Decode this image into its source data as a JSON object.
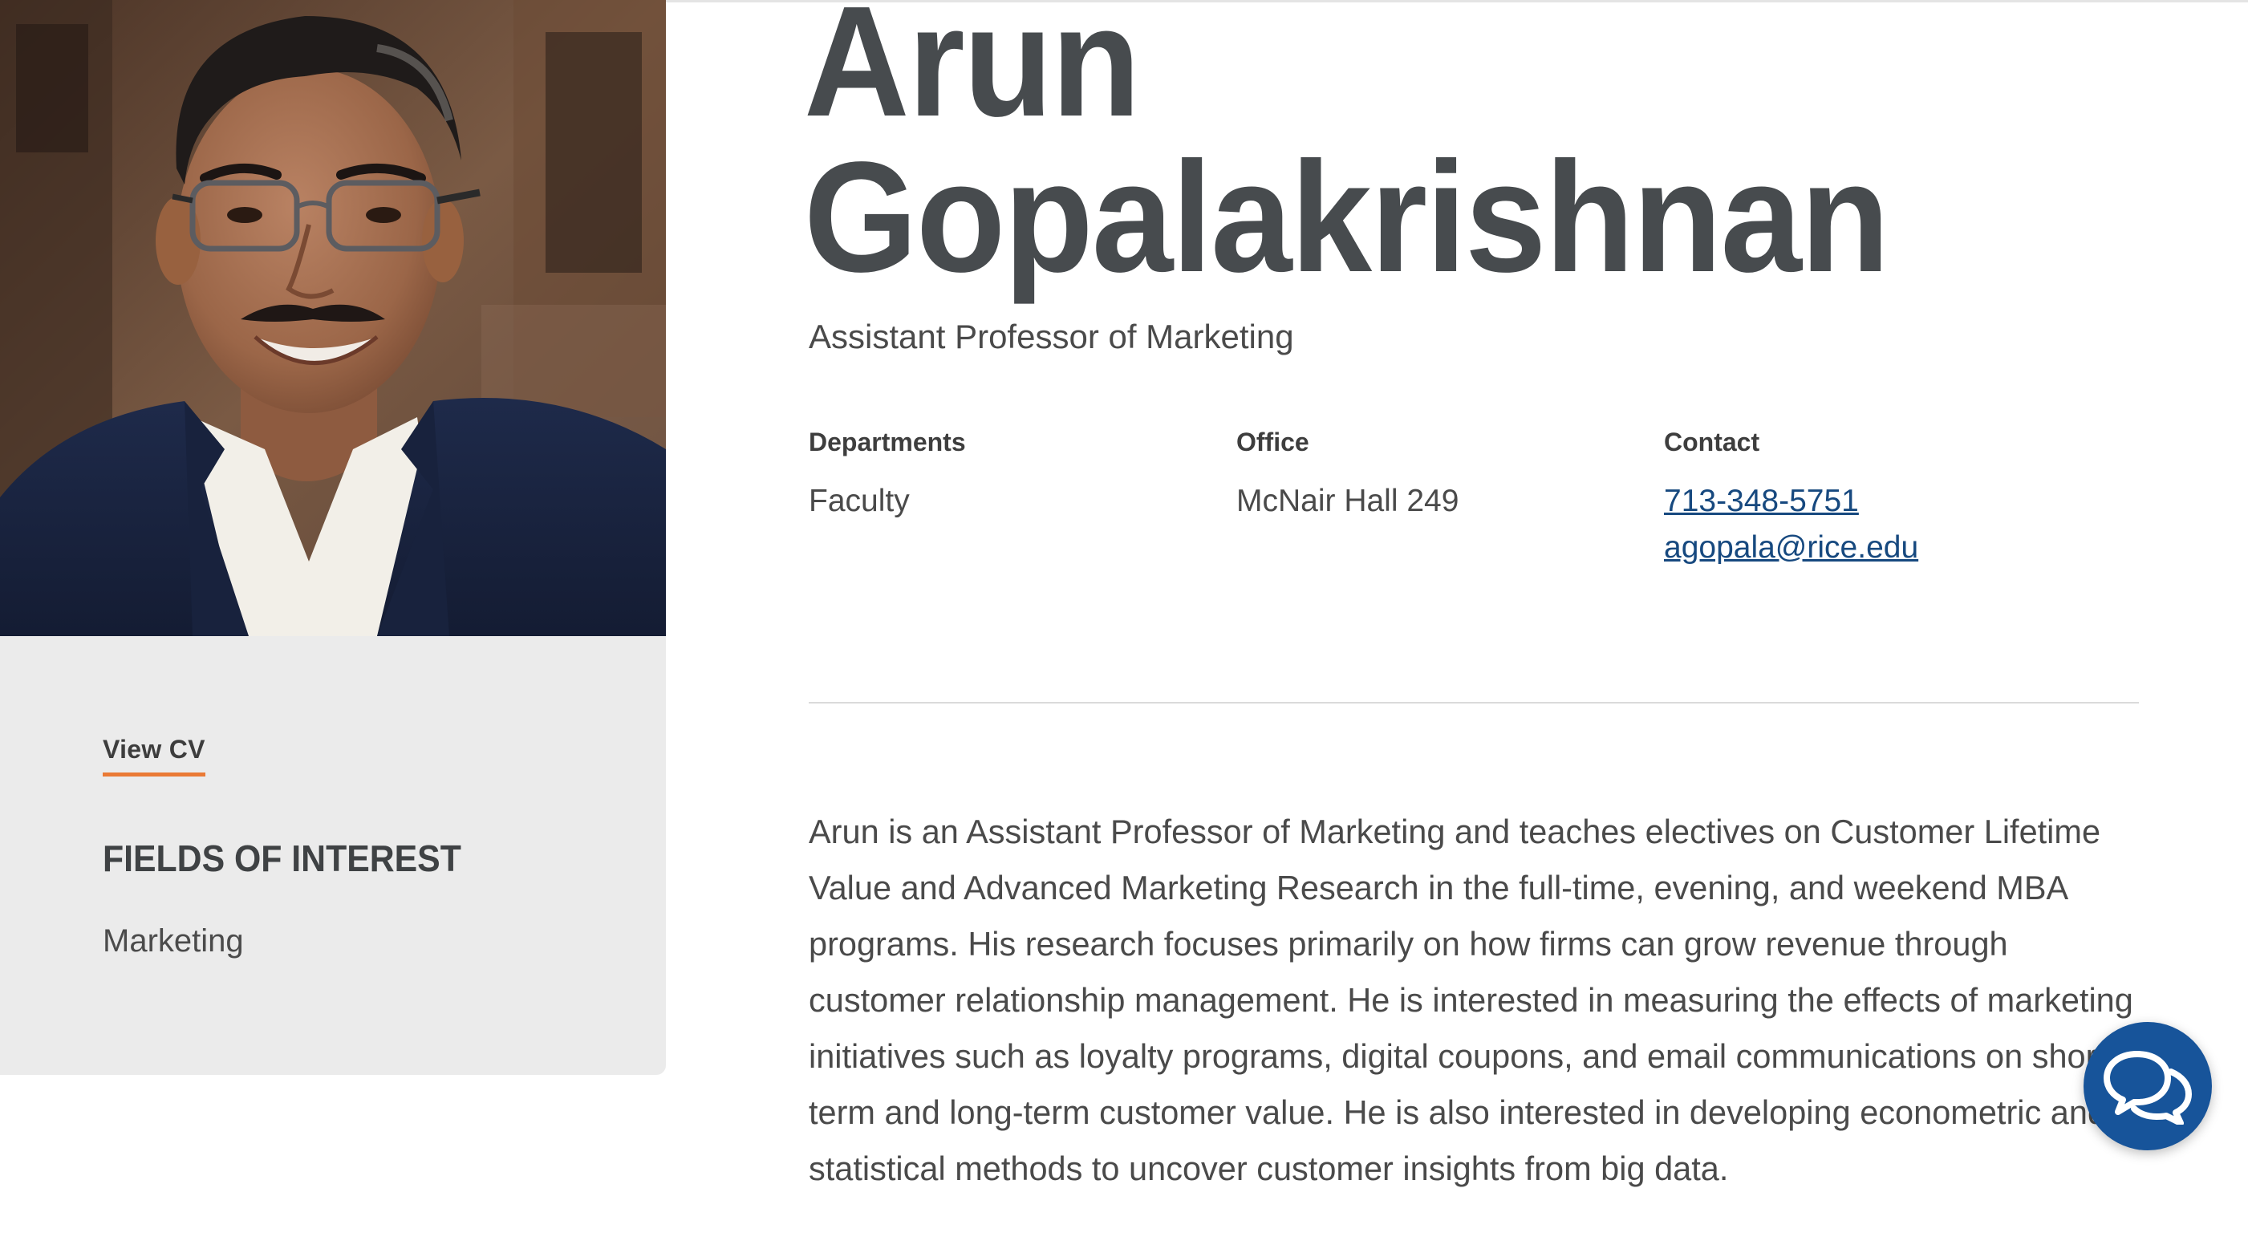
{
  "profile": {
    "name_first": "Arun",
    "name_last": "Gopalakrishnan",
    "title": "Assistant Professor of Marketing",
    "photo_alt": "Portrait of Arun Gopalakrishnan"
  },
  "sidebar": {
    "cv_link": "View CV",
    "fields_heading": "FIELDS OF INTEREST",
    "fields_value": "Marketing"
  },
  "info": {
    "departments_label": "Departments",
    "departments_value": "Faculty",
    "office_label": "Office",
    "office_value": "McNair Hall 249",
    "contact_label": "Contact",
    "phone": "713-348-5751",
    "email": "agopala@rice.edu"
  },
  "bio": "Arun is an Assistant Professor of Marketing and teaches electives on Customer Lifetime Value and Advanced Marketing Research in the full-time, evening, and weekend MBA programs. His research focuses primarily on how firms can grow revenue through customer relationship management. He is interested in measuring the effects of marketing initiatives such as loyalty programs, digital coupons, and email communications on short-term and long-term customer value. He is also interested in developing econometric and statistical methods to uncover customer insights from big data.",
  "chat": {
    "icon": "chat-bubbles-icon",
    "color": "#17549a"
  },
  "colors": {
    "accent": "#ea7a35",
    "link": "#17497f",
    "panel": "#ebebeb",
    "heading": "#474b4e"
  }
}
